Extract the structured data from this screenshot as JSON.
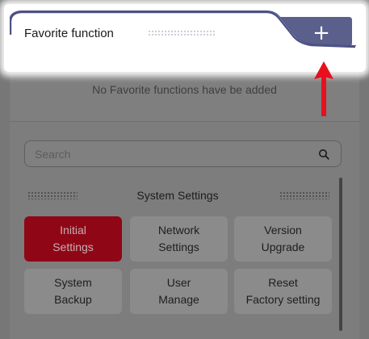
{
  "header": {
    "title": "Favorite function",
    "add_icon": "plus-icon",
    "add_label": "+"
  },
  "empty_message": "No Favorite functions have be added",
  "search": {
    "placeholder": "Search",
    "icon": "search-icon"
  },
  "section": {
    "title": "System Settings"
  },
  "tiles": [
    {
      "line1": "Initial",
      "line2": "Settings",
      "active": true
    },
    {
      "line1": "Network",
      "line2": "Settings",
      "active": false
    },
    {
      "line1": "Version",
      "line2": "Upgrade",
      "active": false
    },
    {
      "line1": "System",
      "line2": "Backup",
      "active": false
    },
    {
      "line1": "User",
      "line2": "Manage",
      "active": false
    },
    {
      "line1": "Reset",
      "line2": "Factory setting",
      "active": false
    }
  ],
  "colors": {
    "active_tile": "#8f0716",
    "tab_accent": "#5a5f8c",
    "arrow": "#e8101e"
  }
}
